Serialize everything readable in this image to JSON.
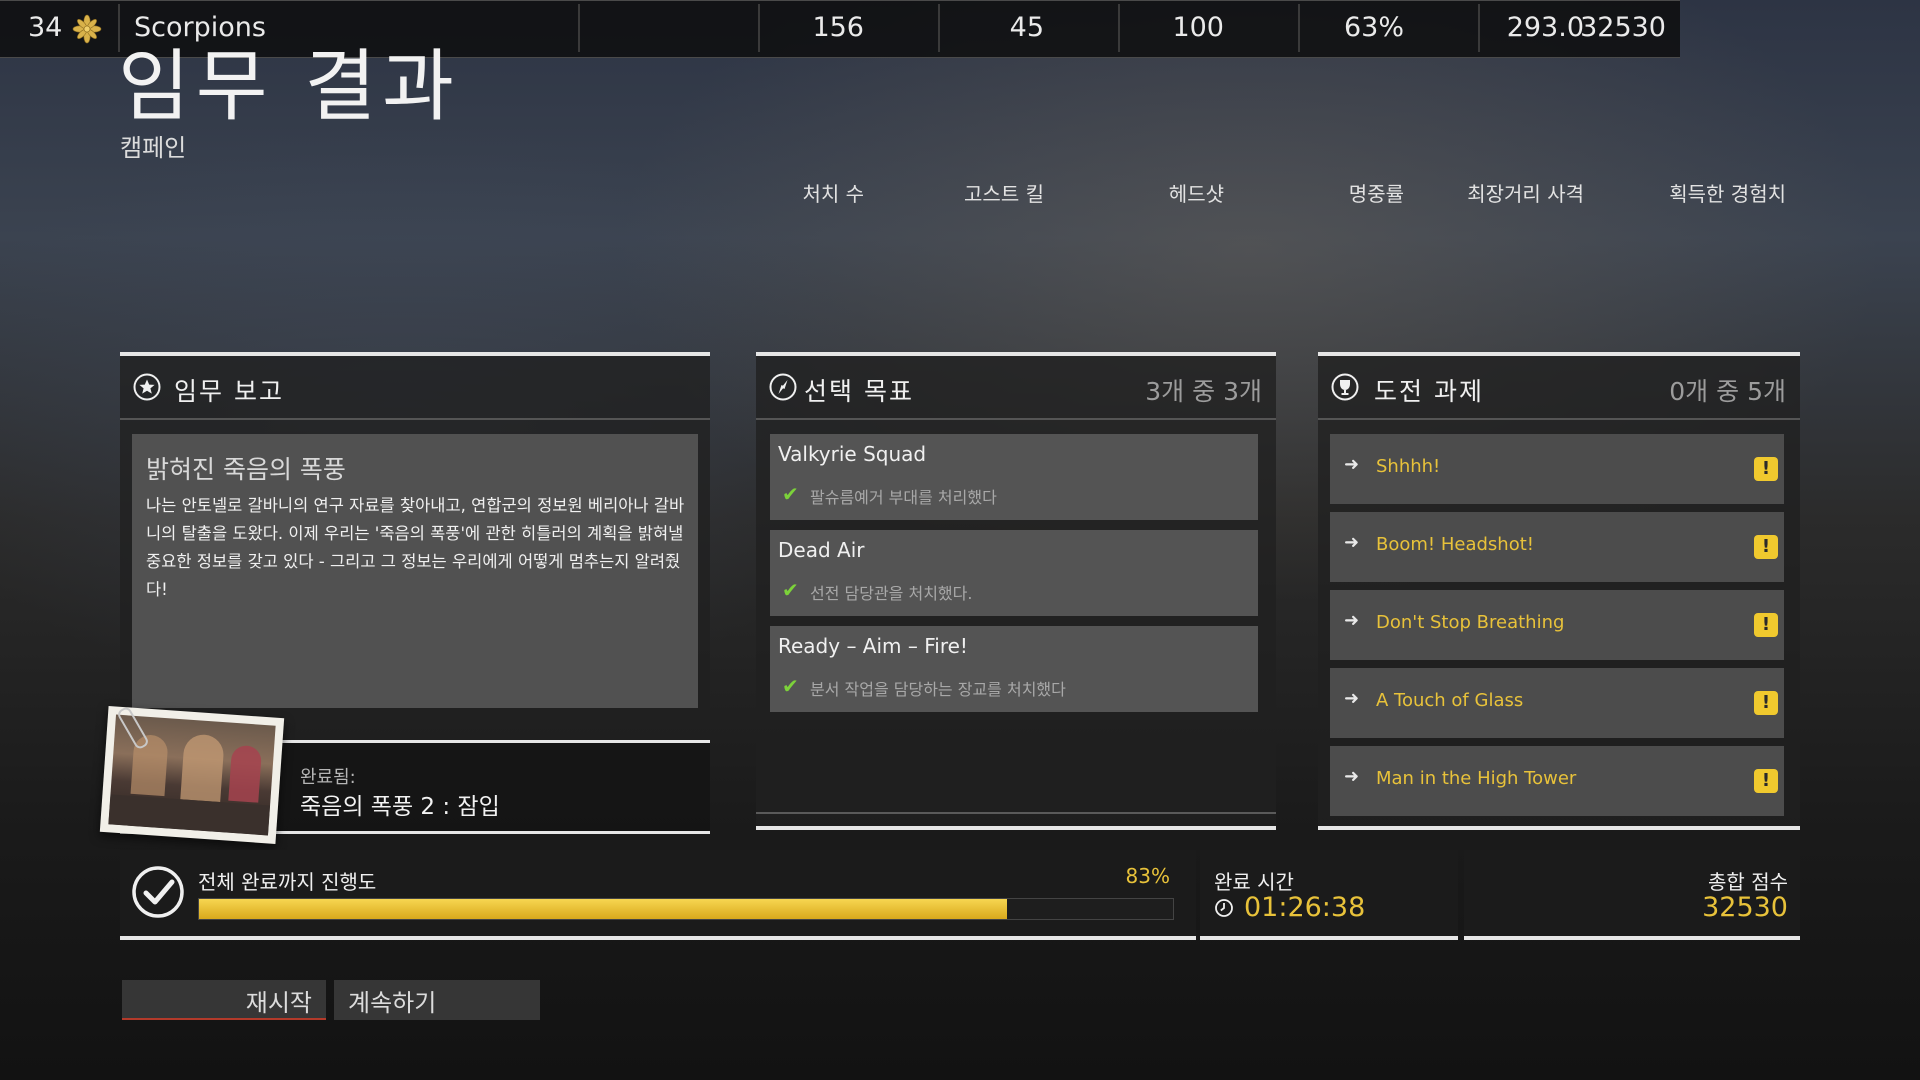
{
  "header": {
    "title": "임무 결과",
    "subtitle": "캠페인"
  },
  "stats": {
    "headers": [
      "처치 수",
      "고스트 킬",
      "헤드샷",
      "명중률",
      "최장거리 사격",
      "획득한 경험치"
    ],
    "rank": "34",
    "name": "Scorpions",
    "values": [
      "156",
      "45",
      "100",
      "63%",
      "293.0",
      "32530"
    ]
  },
  "report": {
    "title": "임무 보고",
    "heading": "밝혀진 죽음의 폭풍",
    "body": "나는 안토넬로 갈바니의 연구 자료를 찾아내고, 연합군의 정보원 베리아나 갈바니의 탈출을 도왔다. 이제 우리는 '죽음의 폭풍'에 관한 히틀러의 계획을 밝혀낼 중요한 정보를 갖고 있다 - 그리고 그 정보는 우리에게 어떻게 멈추는지 알려줬다!",
    "completed_label": "완료됨:",
    "completed_name": "죽음의 폭풍 2 : 잠입"
  },
  "objectives": {
    "title": "선택 목표",
    "count": "3개 중 3개",
    "items": [
      {
        "name": "Valkyrie Squad",
        "desc": "팔슈름예거 부대를 처리했다"
      },
      {
        "name": "Dead Air",
        "desc": "선전 담당관을 처치했다."
      },
      {
        "name": "Ready – Aim – Fire!",
        "desc": "분서 작업을 담당하는 장교를 처치했다"
      }
    ]
  },
  "challenges": {
    "title": "도전 과제",
    "count": "0개 중 5개",
    "items": [
      {
        "name": "Shhhh!"
      },
      {
        "name": "Boom! Headshot!"
      },
      {
        "name": "Don't Stop Breathing"
      },
      {
        "name": "A Touch of Glass"
      },
      {
        "name": "Man in the High Tower"
      }
    ],
    "badge": "!"
  },
  "progress": {
    "label": "전체 완료까지 진행도",
    "value_text": "83%",
    "fraction": 0.83
  },
  "time": {
    "label": "완료 시간",
    "value": "01:26:38"
  },
  "score": {
    "label": "총합 점수",
    "value": "32530"
  },
  "buttons": {
    "restart": "재시작",
    "continue": "계속하기"
  },
  "colors": {
    "accent": "#e8c23a",
    "check": "#7cd23a",
    "bar": "#f2c94c"
  }
}
